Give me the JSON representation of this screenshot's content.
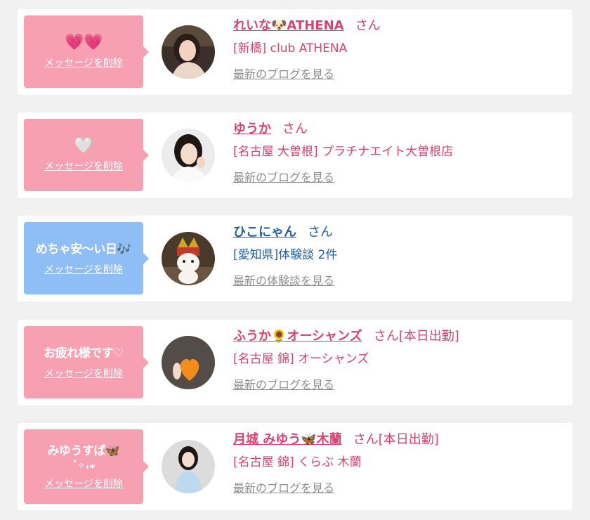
{
  "colors": {
    "pink": "#f6a0b2",
    "blue": "#8fbdf6",
    "name_pink": "#d8436f",
    "name_blue": "#1f5fa6",
    "link_gray": "#8e8e8e"
  },
  "items": [
    {
      "bubble_color": "pink",
      "message": "💗💗",
      "delete_label": "メッセージを削除",
      "name": "れいな🐶ATHENA",
      "honorific": "さん",
      "status": "",
      "shop": "[新橋] club ATHENA",
      "link": "最新のブログを見る",
      "avatar_icon": "woman-photo"
    },
    {
      "bubble_color": "pink",
      "message": "🤍",
      "delete_label": "メッセージを削除",
      "name": "ゆうか",
      "honorific": "さん",
      "status": "",
      "shop": "[名古屋 大曽根] プラチナエイト大曽根店",
      "link": "最新のブログを見る",
      "avatar_icon": "woman-photo"
    },
    {
      "bubble_color": "blue",
      "message": "めちゃ安〜い日🎶",
      "delete_label": "メッセージを削除",
      "name": "ひこにゃん",
      "honorific": "さん",
      "status": "",
      "shop": "[愛知県]体験談 2件",
      "link": "最新の体験談を見る",
      "avatar_icon": "cat-mascot-photo"
    },
    {
      "bubble_color": "pink",
      "message": "お疲れ様です♡",
      "delete_label": "メッセージを削除",
      "name": "ふうか🌻オーシャンズ",
      "honorific": "さん",
      "status": "[本日出勤]",
      "shop": "[名古屋 錦] オーシャンズ",
      "link": "最新のブログを見る",
      "avatar_icon": "heart-covered-photo"
    },
    {
      "bubble_color": "pink",
      "message": "みゆうすぱ🦋",
      "message2": "˚✧₊⁎",
      "delete_label": "メッセージを削除",
      "name": "月城 みゆう🦋木蘭",
      "honorific": "さん",
      "status": "[本日出勤]",
      "shop": "[名古屋 錦] くらぶ 木蘭",
      "link": "最新のブログを見る",
      "avatar_icon": "woman-photo"
    }
  ]
}
